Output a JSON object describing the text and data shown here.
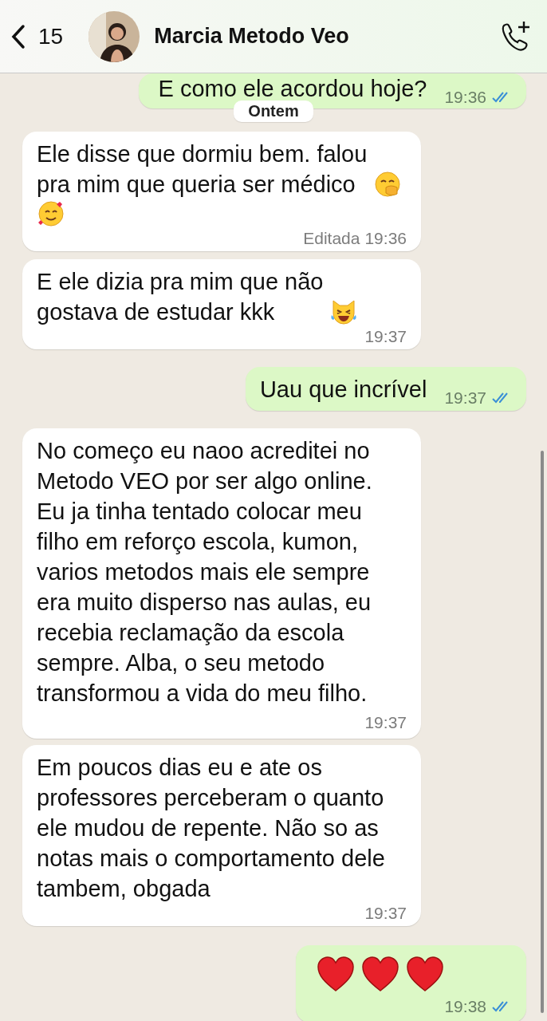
{
  "header": {
    "back_count": "15",
    "contact_name": "Marcia Metodo Veo"
  },
  "messages": [
    {
      "kind": "text",
      "outgoing": true,
      "text": "E como ele acordou hoje?",
      "time": "19:36",
      "read": true,
      "cut_top": true
    },
    {
      "kind": "date",
      "text": "Ontem"
    },
    {
      "kind": "text",
      "outgoing": false,
      "text": "Ele disse que dormiu bem. falou\npra mim que queria ser médico",
      "emoji": [
        {
          "kind": "shy",
          "new_line": false
        },
        {
          "kind": "loving",
          "new_line": true
        }
      ],
      "edited_label": "Editada",
      "time": "19:36"
    },
    {
      "kind": "text",
      "outgoing": false,
      "text": "E ele dizia pra mim que não\ngostava de estudar kkk",
      "emoji": [
        {
          "kind": "laughing",
          "new_line": false
        }
      ],
      "time": "19:37"
    },
    {
      "kind": "text",
      "outgoing": true,
      "text": "Uau que incrível",
      "time": "19:37",
      "read": true
    },
    {
      "kind": "text",
      "outgoing": false,
      "text": "No começo eu naoo acreditei no\nMetodo VEO por ser algo online.\nEu ja tinha tentado colocar meu\nfilho em reforço escola, kumon,\nvarios metodos mais ele sempre\nera muito disperso nas aulas, eu\nrecebia reclamação da escola\nsempre. Alba, o seu metodo\ntransformou a vida do meu filho.",
      "time": "19:37",
      "time_below": true
    },
    {
      "kind": "text",
      "outgoing": false,
      "text": "Em poucos dias eu e ate os\nprofessores perceberam o quanto\nele mudou de repente. Não so as\nnotas mais o comportamento dele\ntambem, obgada",
      "time": "19:37"
    },
    {
      "kind": "hearts",
      "outgoing": true,
      "time": "19:38",
      "read": true
    }
  ]
}
